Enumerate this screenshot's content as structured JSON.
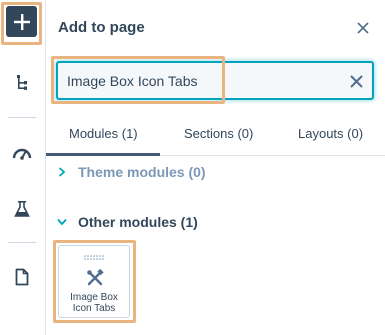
{
  "rail": {
    "items": [
      {
        "name": "add-icon"
      },
      {
        "name": "tree-icon"
      },
      {
        "name": "speedometer-icon"
      },
      {
        "name": "flask-icon"
      },
      {
        "name": "document-icon"
      }
    ]
  },
  "panel": {
    "title": "Add to page",
    "close_icon": "close-icon"
  },
  "search": {
    "value": "Image Box Icon Tabs",
    "placeholder": "",
    "clear_icon": "close-icon"
  },
  "tabs": [
    {
      "label": "Modules (1)",
      "active": true
    },
    {
      "label": "Sections (0)",
      "active": false
    },
    {
      "label": "Layouts (0)",
      "active": false
    }
  ],
  "sections": {
    "theme": {
      "label": "Theme modules (0)",
      "expanded": false
    },
    "other": {
      "label": "Other modules (1)",
      "expanded": true
    }
  },
  "modules": [
    {
      "label_line1": "Image Box",
      "label_line2": "Icon Tabs",
      "icon": "tools-icon"
    }
  ],
  "colors": {
    "accent": "#00a4bd",
    "highlight": "#e9b47f",
    "rail_button": "#33475b",
    "text": "#33475b",
    "muted": "#7c98b6"
  }
}
